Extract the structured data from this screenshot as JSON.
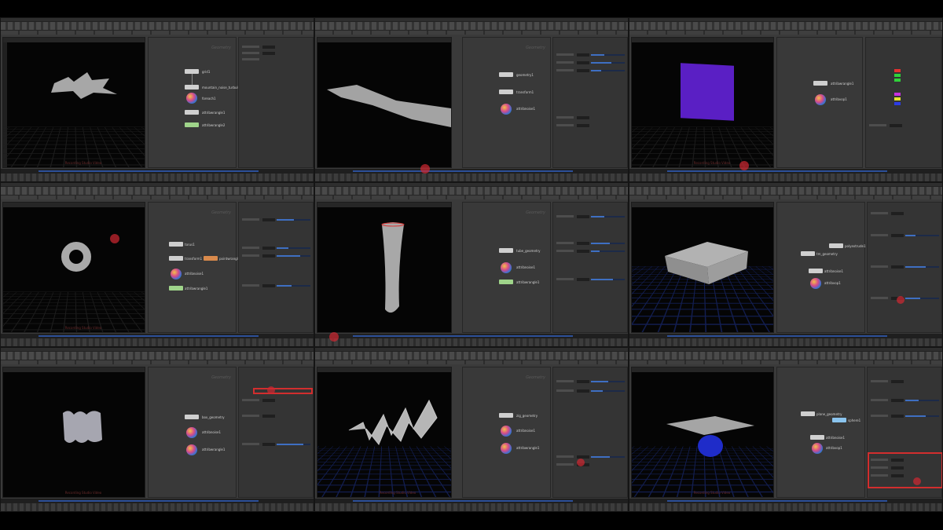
{
  "cells": [
    {
      "viewport_label": "",
      "net_title": "Geometry",
      "nodes": [
        "grid1",
        "mountain_noise_turbulence",
        "foreach1",
        "attribwrangle1",
        "attribwrangle2"
      ],
      "watermark": "Recording Studio Video"
    },
    {
      "viewport_label": "",
      "net_title": "Geometry",
      "nodes": [
        "geometry1",
        "transform1",
        "attribnoise1"
      ],
      "watermark": ""
    },
    {
      "viewport_label": "",
      "net_title": "",
      "nodes": [
        "attribwrangle1",
        "attribvop1"
      ],
      "watermark": "Recording Studio Video"
    },
    {
      "viewport_label": "",
      "net_title": "Geometry",
      "nodes": [
        "torus1",
        "transform1",
        "pointwrangle1",
        "attribnoise1",
        "attribwrangle1"
      ],
      "watermark": "Recording Studio Video"
    },
    {
      "viewport_label": "",
      "net_title": "Geometry",
      "nodes": [
        "tube_geometry",
        "attribnoise1",
        "attribwrangle1"
      ],
      "watermark": ""
    },
    {
      "viewport_label": "",
      "net_title": "",
      "nodes": [
        "tm_geometry",
        "polyextrude1",
        "attribnoise1",
        "attribvop1"
      ],
      "watermark": ""
    },
    {
      "viewport_label": "",
      "net_title": "Geometry",
      "nodes": [
        "box_geometry",
        "attribnoise1",
        "attribwrangle1"
      ],
      "watermark": "Recording Studio Video"
    },
    {
      "viewport_label": "",
      "net_title": "Geometry",
      "nodes": [
        "zig_geometry",
        "attribnoise1",
        "attribwrangle1"
      ],
      "watermark": "Recording Studio Video"
    },
    {
      "viewport_label": "",
      "net_title": "",
      "nodes": [
        "plane_geometry",
        "sphere1",
        "attribnoise1",
        "attribvop1"
      ],
      "watermark": "Recording Studio Video"
    }
  ],
  "colors": {
    "background": "#000000",
    "ui_panel": "#3a3a3a",
    "viewport": "#050505",
    "timeline_accent": "#2c4f98",
    "highlight": "#d22e2e",
    "purple_plane": "#5a1fc4",
    "blue_sphere": "#1f2cc9"
  },
  "icons": [
    "toolbar-shelf-icon",
    "playback-icon",
    "node-icon"
  ]
}
